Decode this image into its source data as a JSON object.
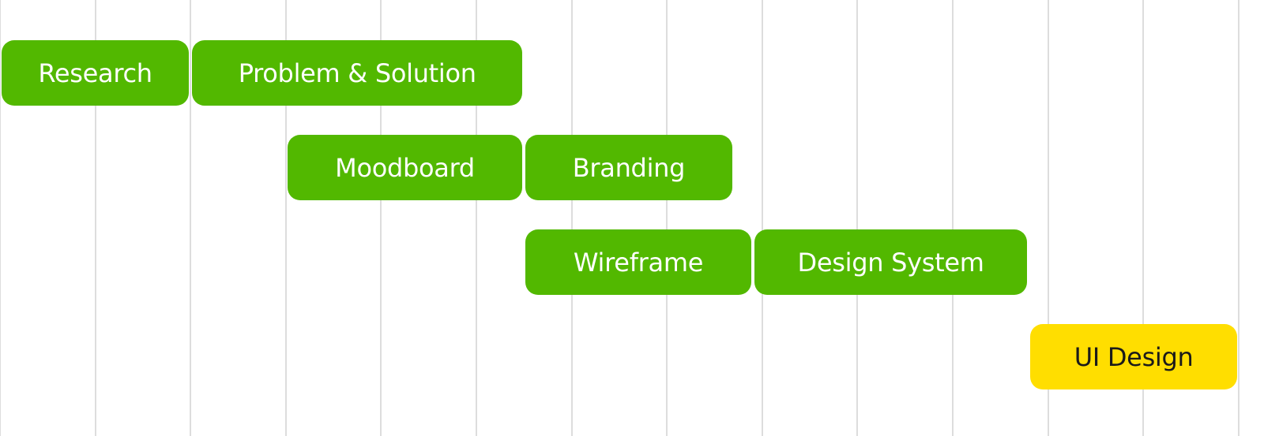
{
  "chart_data": {
    "type": "gantt",
    "title": "",
    "xlabel": "",
    "ylabel": "",
    "columns": 13,
    "grid": true,
    "colors": {
      "default": "#52b800",
      "highlight": "#ffde00",
      "text_default": "#ffffff",
      "text_highlight": "#1a1a1a",
      "grid": "#dddddd"
    },
    "tasks": [
      {
        "label": "Research",
        "row": 0,
        "start": 0,
        "end": 2,
        "highlight": false
      },
      {
        "label": "Problem & Solution",
        "row": 0,
        "start": 2,
        "end": 5.5,
        "highlight": false
      },
      {
        "label": "Moodboard",
        "row": 1,
        "start": 3,
        "end": 5.5,
        "highlight": false
      },
      {
        "label": "Branding",
        "row": 1,
        "start": 5.5,
        "end": 7.7,
        "highlight": false
      },
      {
        "label": "Wireframe",
        "row": 2,
        "start": 5.5,
        "end": 7.9,
        "highlight": false
      },
      {
        "label": "Design System",
        "row": 2,
        "start": 7.9,
        "end": 10.8,
        "highlight": false
      },
      {
        "label": "UI Design",
        "row": 3,
        "start": 10.8,
        "end": 13,
        "highlight": true
      }
    ]
  }
}
